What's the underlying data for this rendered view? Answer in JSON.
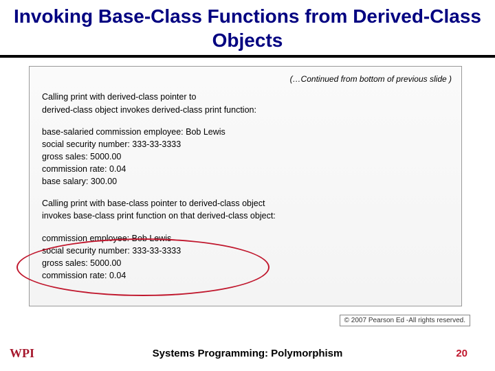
{
  "title": "Invoking Base-Class Functions from Derived-Class Objects",
  "output": {
    "continued": "(…Continued from bottom of previous slide )",
    "header1": "Calling print with derived-class pointer to\nderived-class object invokes derived-class print function:",
    "block1": "base-salaried commission employee: Bob Lewis\nsocial security number: 333-33-3333\ngross sales: 5000.00\ncommission rate: 0.04\nbase salary: 300.00",
    "header2": "Calling print with base-class pointer to derived-class object\ninvokes base-class print function on that derived-class object:",
    "block2": "commission employee: Bob Lewis\nsocial security number: 333-33-3333\ngross sales: 5000.00\ncommission rate: 0.04"
  },
  "copyright": "© 2007 Pearson Ed -All rights reserved.",
  "footer": {
    "course": "Systems Programming:  Polymorphism",
    "page": "20"
  },
  "logo": "WPI"
}
